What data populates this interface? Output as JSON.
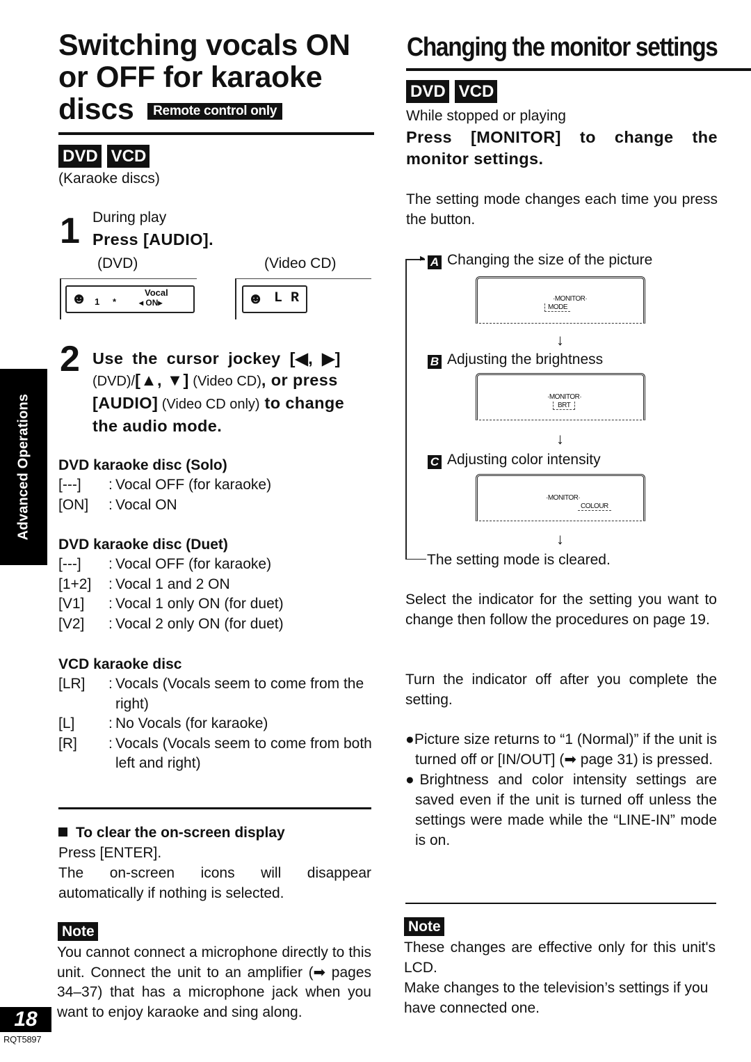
{
  "side_tab": "Advanced Operations",
  "page_number": "18",
  "doc_code": "RQT5897",
  "left": {
    "title_line1": "Switching vocals ON",
    "title_line2": "or OFF for karaoke",
    "title_line3": "discs",
    "remote_badge": "Remote control only",
    "disc_badges": [
      "DVD",
      "VCD"
    ],
    "disc_note": "(Karaoke discs)",
    "step1": {
      "number": "1",
      "pre": "During play",
      "action": "Press [AUDIO].",
      "dvd_label": "(DVD)",
      "vcd_label": "(Video CD)",
      "dvd_display": {
        "track": "1",
        "star": "*",
        "label": "Vocal",
        "value": "◂ ON▸"
      },
      "vcd_display": {
        "value": "L R"
      }
    },
    "step2": {
      "number": "2",
      "line1": "Use the cursor jockey [◀, ▶]",
      "line2_norm": "(DVD)/",
      "line2_bold": "[▲, ▼]",
      "line2_norm2": " (Video CD)",
      "line2_bold2": ", or press",
      "line3_bold": "[AUDIO]",
      "line3_norm": " (Video CD only)",
      "line3_bold2": " to change",
      "line4": "the audio mode."
    },
    "solo": {
      "heading": "DVD karaoke disc (Solo)",
      "rows": [
        {
          "key": "[---]",
          "value": "Vocal OFF (for karaoke)"
        },
        {
          "key": "[ON]",
          "value": "Vocal ON"
        }
      ]
    },
    "duet": {
      "heading": "DVD karaoke disc (Duet)",
      "rows": [
        {
          "key": "[---]",
          "value": "Vocal OFF (for karaoke)"
        },
        {
          "key": "[1+2]",
          "value": "Vocal 1 and 2 ON"
        },
        {
          "key": "[V1]",
          "value": "Vocal 1 only ON (for duet)"
        },
        {
          "key": "[V2]",
          "value": "Vocal 2 only ON (for duet)"
        }
      ]
    },
    "vcd": {
      "heading": "VCD karaoke disc",
      "rows": [
        {
          "key": "[LR]",
          "value": "Vocals (Vocals seem to come from the right)"
        },
        {
          "key": "[L]",
          "value": "No Vocals (for karaoke)"
        },
        {
          "key": "[R]",
          "value": "Vocals (Vocals seem to come from both left and right)"
        }
      ]
    },
    "clear": {
      "heading": "To clear the on-screen display",
      "line1": "Press [ENTER].",
      "line2": "The on-screen icons will disappear automatically if nothing is selected."
    },
    "note": {
      "label": "Note",
      "text": "You cannot connect a microphone directly to this unit. Connect the unit to an amplifier (➡ pages 34–37) that has a microphone jack when you want to enjoy karaoke and sing along."
    }
  },
  "right": {
    "title": "Changing the monitor settings",
    "disc_badges": [
      "DVD",
      "VCD"
    ],
    "pre": "While stopped or playing",
    "instruction": "Press [MONITOR] to change the monitor settings.",
    "desc": "The setting mode changes each time you press the button.",
    "modes": [
      {
        "letter": "A",
        "label": "Changing the size of the picture",
        "display_top": "·MONITOR·",
        "display_bottom": "MODE"
      },
      {
        "letter": "B",
        "label": "Adjusting the brightness",
        "display_top": "·MONITOR·",
        "display_bottom": "BRT"
      },
      {
        "letter": "C",
        "label": "Adjusting color intensity",
        "display_top": "·MONITOR·",
        "display_bottom": "COLOUR"
      }
    ],
    "cleared": "The setting mode is cleared.",
    "select_text": "Select the indicator for the setting you want to change then follow the procedures on page 19.",
    "turn_off_text": "Turn the indicator off after you complete the setting.",
    "bullets": [
      "Picture size returns to “1 (Normal)” if the unit is turned off or [IN/OUT] (➡ page 31) is pressed.",
      "Brightness and color intensity settings are saved even if the unit is turned off unless the settings were made while the “LINE-IN” mode is on."
    ],
    "note": {
      "label": "Note",
      "line1": "These changes are effective only for this unit's LCD.",
      "line2": "Make changes to the television’s settings if you have connected one."
    }
  }
}
